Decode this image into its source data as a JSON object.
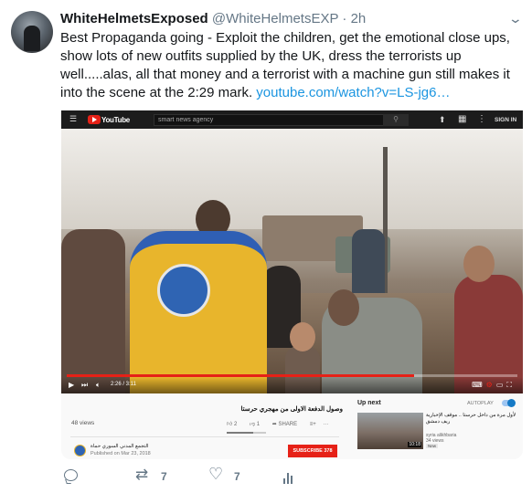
{
  "tweet": {
    "display_name": "WhiteHelmetsExposed",
    "handle": "@WhiteHelmetsEXP",
    "separator": "·",
    "time": "2h",
    "text": "Best Propaganda going - Exploit the children, get the emotional close ups, show lots of new outfits supplied by the UK, dress the terrorists up well.....alas, all that money and a terrorist with a machine gun still makes it into the scene at the 2:29 mark.",
    "link": "youtube.com/watch?v=LS-jg6…",
    "actions": {
      "reply_count": "",
      "retweet_count": "7",
      "like_count": "7"
    }
  },
  "youtube": {
    "logo_text": "YouTube",
    "search_text": "smart news agency",
    "signin_label": "SIGN IN",
    "player": {
      "time": "2:26 / 3:11",
      "progress_fraction": 0.77
    },
    "video": {
      "title": "وصول الدفعة الاولى من مهجري حرستا",
      "views": "48 views",
      "likes": "2",
      "dislikes": "1",
      "share_label": "SHARE",
      "like_fraction": 0.67
    },
    "channel": {
      "name": "التجمع المدني السوري حماة",
      "published": "Published on Mar 23, 2018",
      "subscribe_label": "SUBSCRIBE",
      "subscriber_count": "378"
    },
    "sidebar": {
      "up_next_label": "Up next",
      "autoplay_label": "AUTOPLAY",
      "related": {
        "title": "لأول مرة من داخل حرستا .. موقف الإخبارية ريف دمشق",
        "channel": "syria alikhbaria",
        "views": "34 views",
        "badge": "New",
        "duration": "10:18"
      }
    }
  },
  "colors": {
    "link": "#1b95e0",
    "youtube_red": "#e62117",
    "muted": "#657786"
  },
  "icons": [
    "chevron-down-icon",
    "reply-icon",
    "retweet-icon",
    "heart-icon",
    "analytics-icon",
    "menu-icon",
    "youtube-logo-icon",
    "search-icon",
    "upload-icon",
    "apps-icon",
    "more-icon",
    "play-icon",
    "next-icon",
    "volume-icon"
  ]
}
